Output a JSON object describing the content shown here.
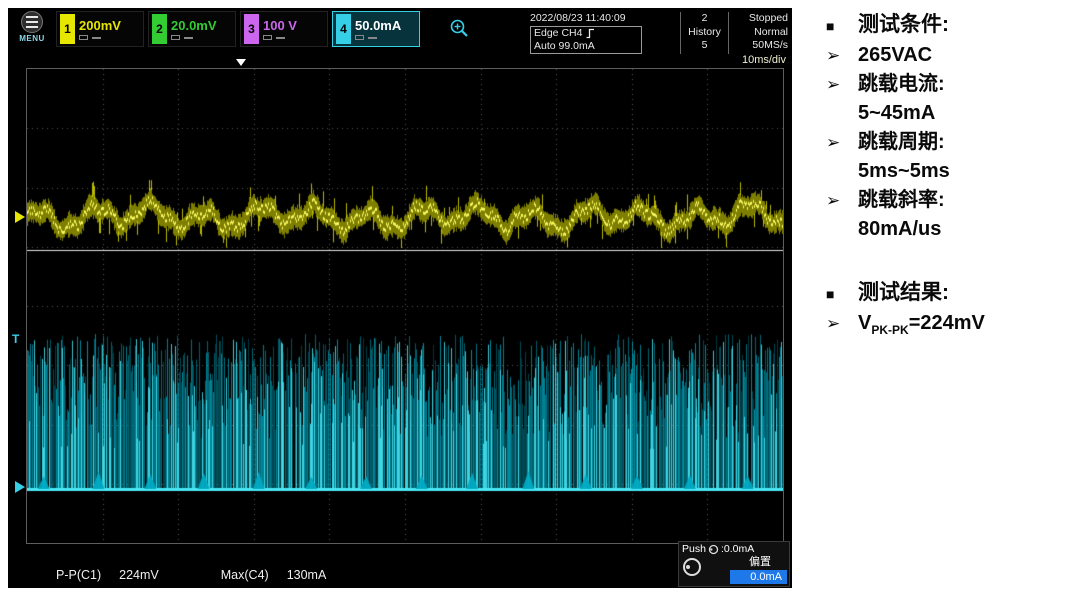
{
  "scope": {
    "menu_label": "MENU",
    "channels": [
      {
        "num": "1",
        "value": "200mV"
      },
      {
        "num": "2",
        "value": "20.0mV"
      },
      {
        "num": "3",
        "value": "100 V"
      },
      {
        "num": "4",
        "value": "50.0mA"
      }
    ],
    "datetime": "2022/08/23 11:40:09",
    "trigger": {
      "source": "Edge CH4",
      "mode": "Auto 99.0mA"
    },
    "acquisition": {
      "history_count": "2",
      "status": "Stopped",
      "history_label": "History",
      "mode": "Normal",
      "history_index": "5",
      "sample_rate": "50MS/s"
    },
    "timebase": "10ms/div",
    "measurements": [
      {
        "label": "P-P(C1)",
        "value": "224mV"
      },
      {
        "label": "Max(C4)",
        "value": "130mA"
      }
    ],
    "offset_panel": {
      "push_label": "Push",
      "push_value": ":0.0mA",
      "title": "偏置",
      "value": "0.0mA"
    },
    "markers": {
      "trigger_level": "T"
    },
    "colors": {
      "ch1": "#e6e600",
      "ch1_bright": "#ffff66",
      "ch2": "#33cc33",
      "ch3": "#cc66ee",
      "ch4": "#22c8e2",
      "ch4_dim": "#00aac3",
      "ch4_bright": "#49e8f4",
      "offset_value_bg": "#1e78e8"
    }
  },
  "notes": {
    "square_bullet": "■",
    "arrow_bullet": "➢",
    "section1": {
      "title": "测试条件:"
    },
    "items": [
      {
        "line1": "265VAC",
        "line2": ""
      },
      {
        "line1": "跳载电流:",
        "line2": "5~45mA"
      },
      {
        "line1": "跳载周期:",
        "line2": "5ms~5ms"
      },
      {
        "line1": "跳载斜率:",
        "line2": "80mA/us"
      }
    ],
    "section2": {
      "title": "测试结果:"
    },
    "result": {
      "pre": "V",
      "sub": "PK-PK",
      "post": "=224mV"
    }
  }
}
